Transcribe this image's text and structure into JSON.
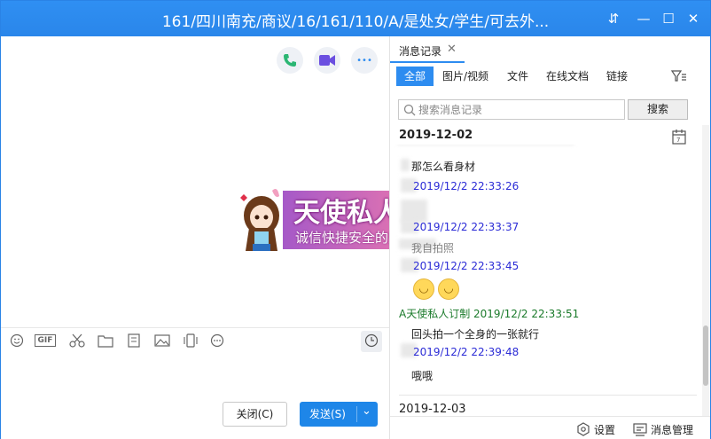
{
  "window": {
    "title": "161/四川南充/商议/16/161/110/A/是处女/学生/可去外...",
    "controls": {
      "pin": "⇵",
      "minimize": "—",
      "maximize": "☐",
      "close": "✕"
    }
  },
  "chat": {
    "actions": [
      "phone-call",
      "video-call",
      "more"
    ],
    "more_label": "•••",
    "banner": {
      "line1": "天使私人订制",
      "line2": "诚信快捷安全的交友平台"
    },
    "toolbar": {
      "gif_label": "GIF"
    },
    "close_button": "关闭(C)",
    "send_button": "发送(S)",
    "send_dropdown": "⌄"
  },
  "history": {
    "tab_label": "消息记录",
    "tab_close": "✕",
    "filters": [
      "全部",
      "图片/视频",
      "文件",
      "在线文档",
      "链接"
    ],
    "search_placeholder": "搜索消息记录",
    "search_button": "搜索",
    "date1": "2019-12-02",
    "messages": [
      {
        "time": "2019/12/2 22:33:26",
        "text": "那怎么看身材"
      },
      {
        "time": "2019/12/2 22:33:37",
        "text": ""
      },
      {
        "time": "2019/12/2 22:33:45",
        "text": "我自拍照"
      },
      {
        "sender": "A天使私人订制 2019/12/2 22:33:51",
        "text": "回头拍一个全身的一张就行"
      },
      {
        "time": "2019/12/2 22:39:48",
        "text": "哦哦"
      }
    ],
    "date2": "2019-12-03",
    "settings_label": "设置",
    "manage_label": "消息管理"
  }
}
